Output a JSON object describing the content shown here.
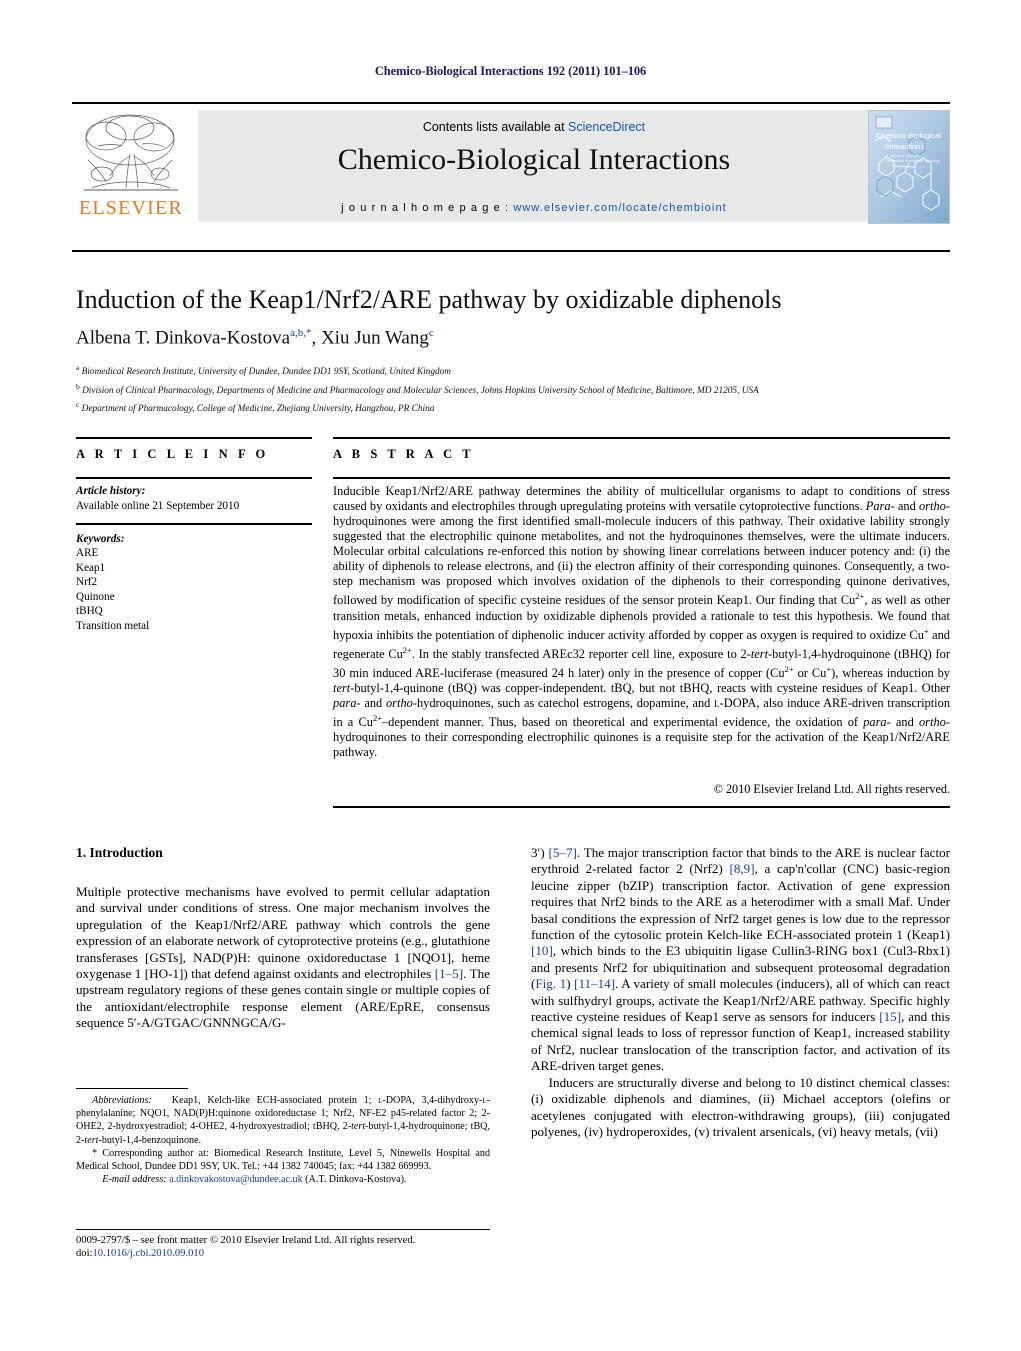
{
  "running_head": "Chemico-Biological Interactions 192 (2011) 101–106",
  "masthead": {
    "contents_prefix": "Contents lists available at ",
    "sciencedirect": "ScienceDirect",
    "journal_title": "Chemico-Biological Interactions",
    "homepage_label": "j o u r n a l   h o m e p a g e :  ",
    "homepage_url": "www.elsevier.com/locate/chembioint",
    "publisher_wordmark": "ELSEVIER",
    "cover_title_line1": "Chemico-Biological",
    "cover_title_line2": "Interactions",
    "cover_subtitle": "A Journal of Molecular, Cellular and Biochemical Toxicology",
    "accent_orange": "#E87722",
    "link_blue": "#1a54a6",
    "band_gray": "#e7e8ea"
  },
  "article": {
    "title": "Induction of the Keap1/Nrf2/ARE pathway by oxidizable diphenols",
    "authors_html": "Albena T. Dinkova-Kostova<sup>a,b,</sup><sup>*</sup>, Xiu Jun Wang<sup>c</sup>",
    "affiliations": [
      {
        "marker": "a",
        "text": "Biomedical Research Institute, University of Dundee, Dundee DD1 9SY, Scotland, United Kingdom"
      },
      {
        "marker": "b",
        "text": "Division of Clinical Pharmacology, Departments of Medicine and Pharmacology and Molecular Sciences, Johns Hopkins University School of Medicine, Baltimore, MD 21205, USA"
      },
      {
        "marker": "c",
        "text": "Department of Pharmacology, College of Medicine, Zhejiang University, Hangzhou, PR China"
      }
    ]
  },
  "article_info": {
    "heading": "A R T I C L E   I N F O",
    "history_label": "Article history:",
    "history_value": "Available online 21 September 2010",
    "keywords_label": "Keywords:",
    "keywords": [
      "ARE",
      "Keap1",
      "Nrf2",
      "Quinone",
      "tBHQ",
      "Transition metal"
    ]
  },
  "abstract": {
    "heading": "A B S T R A C T",
    "body_html": "Inducible Keap1/Nrf2/ARE pathway determines the ability of multicellular organisms to adapt to conditions of stress caused by oxidants and electrophiles through upregulating proteins with versatile cytoprotective functions. <i>Para</i>- and <i>ortho</i>-hydroquinones were among the first identified small-molecule inducers of this pathway. Their oxidative lability strongly suggested that the electrophilic quinone metabolites, and not the hydroquinones themselves, were the ultimate inducers. Molecular orbital calculations re-enforced this notion by showing linear correlations between inducer potency and: (i) the ability of diphenols to release electrons, and (ii) the electron affinity of their corresponding quinones. Consequently, a two-step mechanism was proposed which involves oxidation of the diphenols to their corresponding quinone derivatives, followed by modification of specific cysteine residues of the sensor protein Keap1. Our finding that Cu<sup>2+</sup>, as well as other transition metals, enhanced induction by oxidizable diphenols provided a rationale to test this hypothesis. We found that hypoxia inhibits the potentiation of diphenolic inducer activity afforded by copper as oxygen is required to oxidize Cu<sup>+</sup> and regenerate Cu<sup>2+</sup>. In the stably transfected AREc32 reporter cell line, exposure to 2-<i>tert</i>-butyl-1,4-hydroquinone (tBHQ) for 30 min induced ARE-luciferase (measured 24 h later) only in the presence of copper (Cu<sup>2+</sup> or Cu<sup>+</sup>), whereas induction by <i>tert</i>-butyl-1,4-quinone (tBQ) was copper-independent. tBQ, but not tBHQ, reacts with cysteine residues of Keap1. Other <i>para</i>- and <i>ortho</i>-hydroquinones, such as catechol estrogens, dopamine, and <span style=\"font-variant:small-caps\">l</span>-DOPA, also induce ARE-driven transcription in a Cu<sup>2+</sup>–dependent manner. Thus, based on theoretical and experimental evidence, the oxidation of <i>para</i>- and <i>ortho</i>-hydroquinones to their corresponding electrophilic quinones is a requisite step for the activation of the Keap1/Nrf2/ARE pathway.",
    "copyright": "© 2010 Elsevier Ireland Ltd. All rights reserved."
  },
  "body": {
    "section_title": "1.  Introduction",
    "left_paragraphs_html": [
      "Multiple protective mechanisms have evolved to permit cellular adaptation and survival under conditions of stress. One major mechanism involves the upregulation of the Keap1/Nrf2/ARE pathway which controls the gene expression of an elaborate network of cytoprotective proteins (e.g., glutathione transferases [GSTs], NAD(P)H: quinone oxidoreductase 1 [NQO1], heme oxygenase 1 [HO-1]) that defend against oxidants and electrophiles <span class=\"ref\">[1–5]</span>. The upstream regulatory regions of these genes contain single or multiple copies of the antioxidant/electrophile response element (ARE/EpRE, consensus sequence 5′-A/GTGAC/GNNNGCA/G-"
    ],
    "right_paragraphs_html": [
      "3′) <span class=\"ref\">[5–7]</span>. The major transcription factor that binds to the ARE is nuclear factor erythroid 2-related factor 2 (Nrf2) <span class=\"ref\">[8,9]</span>, a cap'n'collar (CNC) basic-region leucine zipper (bZIP) transcription factor. Activation of gene expression requires that Nrf2 binds to the ARE as a heterodimer with a small Maf. Under basal conditions the expression of Nrf2 target genes is low due to the repressor function of the cytosolic protein Kelch-like ECH-associated protein 1 (Keap1) <span class=\"ref\">[10]</span>, which binds to the E3 ubiquitin ligase Cullin3-RING box1 (Cul3-Rbx1) and presents Nrf2 for ubiquitination and subsequent proteosomal degradation (<span class=\"ref\">Fig. 1</span>) <span class=\"ref\">[11–14]</span>. A variety of small molecules (inducers), all of which can react with sulfhydryl groups, activate the Keap1/Nrf2/ARE pathway. Specific highly reactive cysteine residues of Keap1 serve as sensors for inducers <span class=\"ref\">[15]</span>, and this chemical signal leads to loss of repressor function of Keap1, increased stability of Nrf2, nuclear translocation of the transcription factor, and activation of its ARE-driven target genes.",
      "Inducers are structurally diverse and belong to 10 distinct chemical classes: (i) oxidizable diphenols and diamines, (ii) Michael acceptors (olefins or acetylenes conjugated with electron-withdrawing groups), (iii) conjugated polyenes, (iv) hydroperoxides, (v) trivalent arsenicals, (vi) heavy metals, (vii)"
    ]
  },
  "footnotes": {
    "abbreviations_html": "<span class=\"it\">Abbreviations:</span>&nbsp;&nbsp; Keap1, Kelch-like ECH-associated protein 1; <span style=\"font-variant:small-caps\">l</span>-DOPA, 3,4-dihydroxy-<span style=\"font-variant:small-caps\">l</span>-phenylalanine; NQO1, NAD(P)H:quinone oxidoreductase 1; Nrf2, NF-E2 p45-related factor 2; 2-OHE2, 2-hydroxyestradiol; 4-OHE2, 4-hydroxyestradiol; tBHQ, 2-<span class=\"it\">tert</span>-butyl-1,4-hydroquinone; tBQ, 2-<span class=\"it\">tert</span>-butyl-1,4-benzoquinone.",
    "corresponding_html": "* Corresponding author at: Biomedical Research Institute, Level 5, Ninewells Hospital and Medical School, Dundee DD1 9SY, UK. Tel.: +44 1382 740045; fax: +44 1382 669993.",
    "email_label": "E-mail address:",
    "email_value": "a.dinkovakostova@dundee.ac.uk",
    "email_attribution": "(A.T. Dinkova-Kostova)."
  },
  "footer": {
    "front_matter": "0009-2797/$ – see front matter © 2010 Elsevier Ireland Ltd. All rights reserved.",
    "doi_label": "doi:",
    "doi_value": "10.1016/j.cbi.2010.09.010"
  }
}
